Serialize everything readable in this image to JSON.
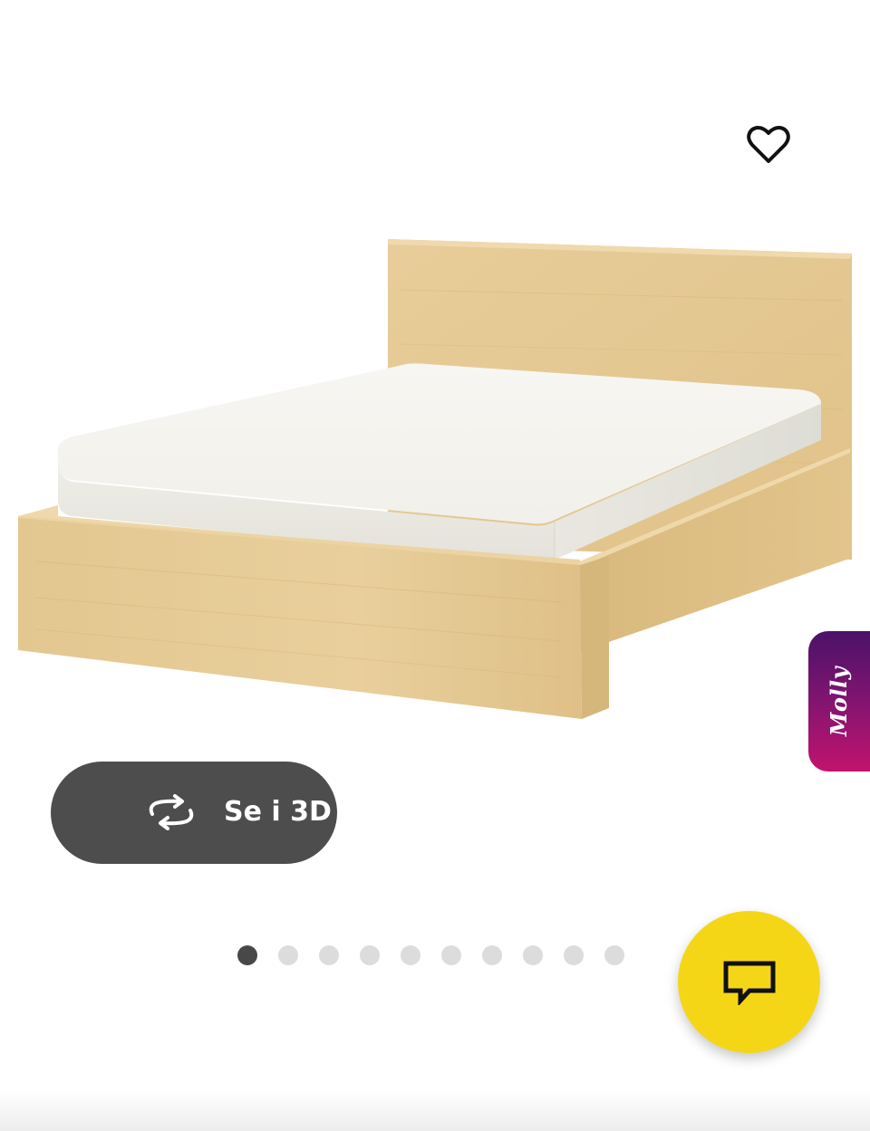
{
  "gallery": {
    "image_alt": "",
    "favorite_icon": "heart-outline-icon",
    "view_3d_icon": "rotate-3d-icon",
    "view_3d_label": "Se i 3D",
    "dots": 10,
    "active_dot": 1
  },
  "assistant_tab": {
    "label": "Molly",
    "colors": [
      "#4b1267",
      "#c2136e"
    ]
  },
  "chat_button": {
    "icon": "chat-bubble-icon",
    "color": "#f5d617"
  },
  "colors": {
    "wood": "#e4c996",
    "mattress": "#f4f3ef",
    "button_dark": "#4d4d4d",
    "dot_active": "#484848",
    "dot_inactive": "#dcdcdc"
  }
}
